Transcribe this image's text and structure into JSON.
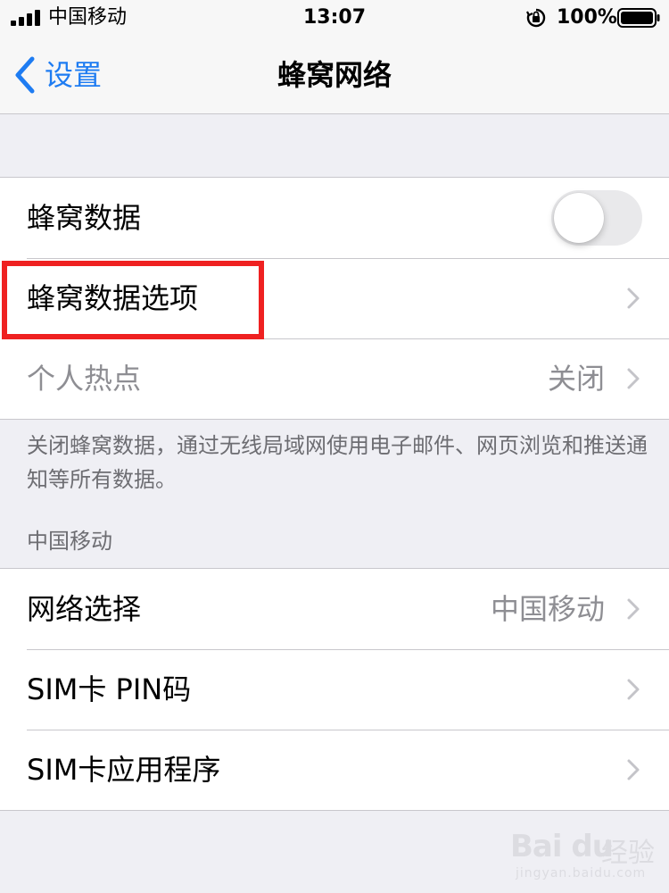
{
  "status_bar": {
    "carrier": "中国移动",
    "time": "13:07",
    "battery_percent": "100%",
    "battery_level": 1.0,
    "signal_bars": 4,
    "icons": [
      "signal-icon",
      "orientation-lock-icon",
      "battery-icon"
    ]
  },
  "nav": {
    "back_label": "设置",
    "title": "蜂窝网络",
    "back_icon": "chevron-left-icon"
  },
  "group1": {
    "cellular_data": {
      "label": "蜂窝数据",
      "toggle_on": false
    },
    "cellular_data_options": {
      "label": "蜂窝数据选项",
      "highlighted": true
    },
    "personal_hotspot": {
      "label": "个人热点",
      "value": "关闭"
    }
  },
  "footer_note": "关闭蜂窝数据，通过无线局域网使用电子邮件、网页浏览和推送通知等所有数据。",
  "carrier_section": {
    "header": "中国移动",
    "network_selection": {
      "label": "网络选择",
      "value": "中国移动"
    },
    "sim_pin": {
      "label": "SIM卡 PIN码"
    },
    "sim_apps": {
      "label": "SIM卡应用程序"
    }
  },
  "colors": {
    "accent": "#1e7cf2",
    "highlight": "#ef2121",
    "background": "#efeff4",
    "secondary_text": "#8e8e93"
  },
  "watermark": {
    "logo": "Bai du",
    "text": "经验",
    "url": "jingyan.baidu.com"
  }
}
